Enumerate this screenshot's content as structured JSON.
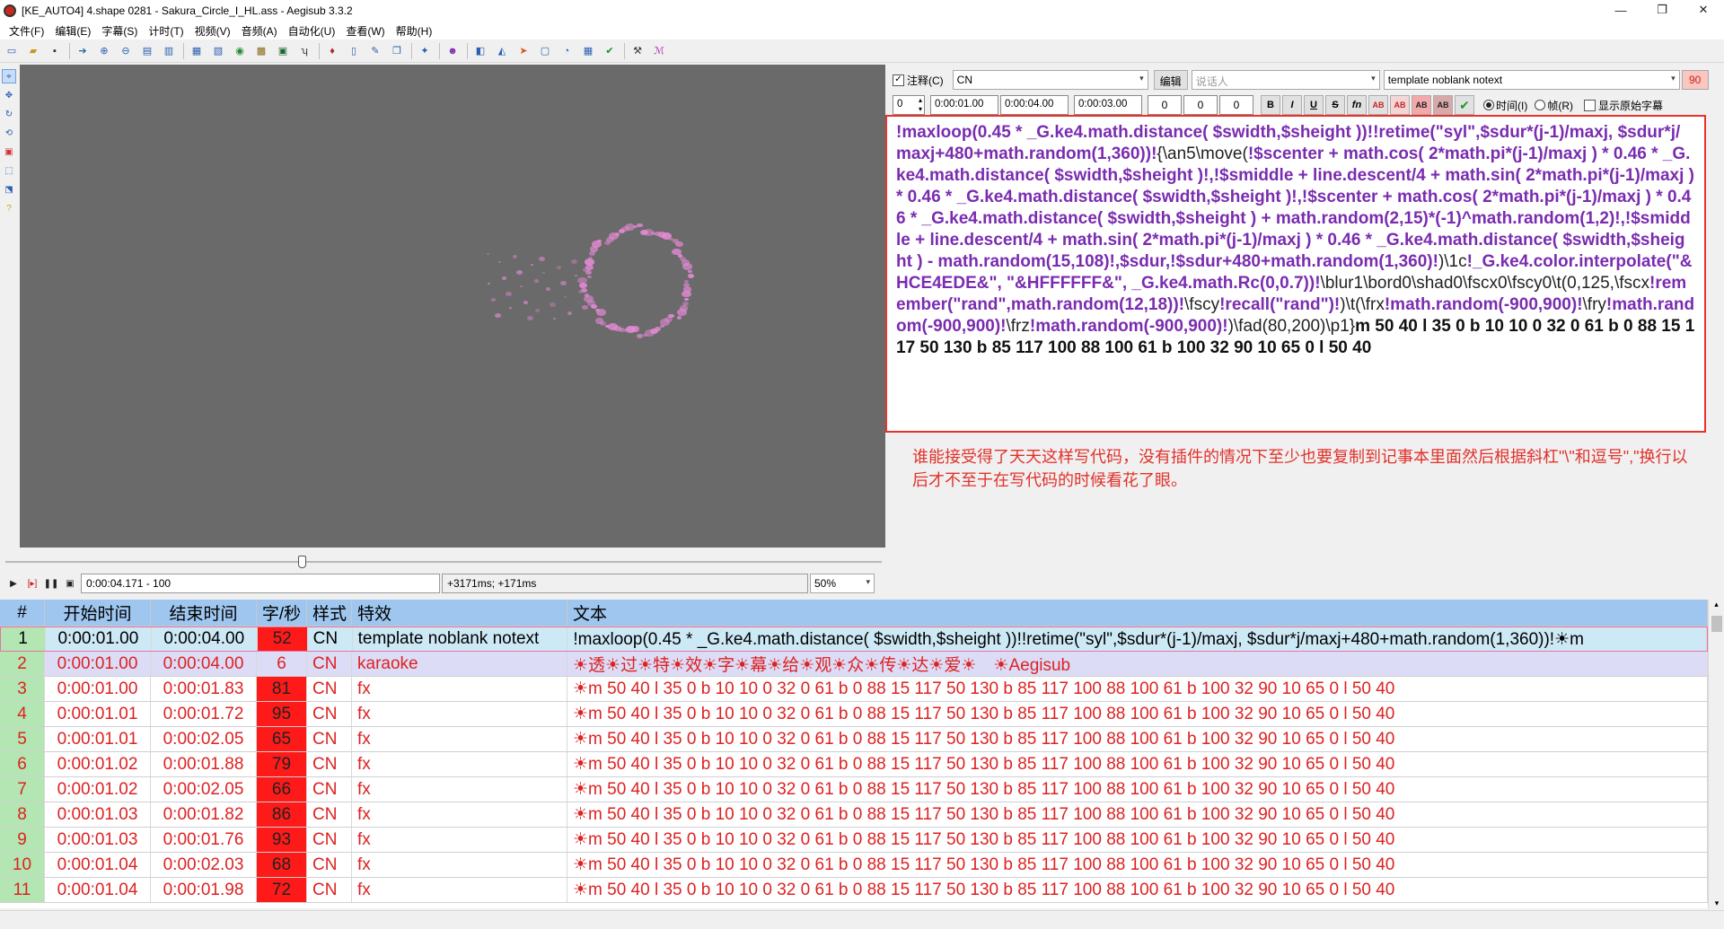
{
  "window": {
    "title": "[KE_AUTO4] 4.shape 0281 - Sakura_Circle_I_HL.ass - Aegisub 3.3.2",
    "controls": [
      "—",
      "❐",
      "✕"
    ]
  },
  "menu": [
    "文件(F)",
    "编辑(E)",
    "字幕(S)",
    "计时(T)",
    "视频(V)",
    "音频(A)",
    "自动化(U)",
    "查看(W)",
    "帮助(H)"
  ],
  "video_controls": {
    "time_display": "0:00:04.171 - 100",
    "offset_display": "+3171ms; +171ms",
    "zoom": "50%"
  },
  "edit": {
    "comment_label": "注释(C)",
    "style": "CN",
    "edit_button": "编辑",
    "actor_placeholder": "说话人",
    "effect": "template noblank notext",
    "char_count": "90",
    "layer": "0",
    "start_time": "0:00:01.00",
    "end_time": "0:00:04.00",
    "duration": "0:00:03.00",
    "margin_l": "0",
    "margin_r": "0",
    "margin_v": "0",
    "format_buttons": [
      "B",
      "I",
      "U",
      "S",
      "fn",
      "AB",
      "AB",
      "AB",
      "AB",
      "✔"
    ],
    "radio_time": "时间(I)",
    "radio_frame": "帧(R)",
    "show_original": "显示原始字幕",
    "code_parts": {
      "p1": "!maxloop(0.45 * _G.ke4.math.distance( $swidth,$sheight ))!!retime(\"syl\",$sdur*(j-1)/maxj, $sdur*j/maxj+480+math.random(1,360))!",
      "p2": "{\\an5\\move(",
      "p3": "!$scenter + math.cos( 2*math.pi*(j-1)/maxj ) * 0.46 * _G.ke4.math.distance( $swidth,$sheight )!,!$smiddle + line.descent/4 + math.sin( 2*math.pi*(j-1)/maxj ) * 0.46 * _G.ke4.math.distance( $swidth,$sheight )!,!$scenter + math.cos( 2*math.pi*(j-1)/maxj ) * 0.46 * _G.ke4.math.distance( $swidth,$sheight ) + math.random(2,15)*(-1)^math.random(1,2)!,!$smiddle + line.descent/4 + math.sin( 2*math.pi*(j-1)/maxj ) * 0.46 * _G.ke4.math.distance( $swidth,$sheight ) - math.random(15,108)!,$sdur,!$sdur+480+math.random(1,360)!",
      "p4": ")\\1c",
      "p5": "!_G.ke4.color.interpolate(\"&HCE4EDE&\", \"&HFFFFFF&\", _G.ke4.math.Rc(0,0.7))!",
      "p6": "\\blur1\\bord0\\shad0\\fscx0\\fscy0\\t(0,125,\\fscx",
      "p7": "!remember(\"rand\",math.random(12,18))!",
      "p8": "\\fscy",
      "p9": "!recall(\"rand\")!",
      "p10": ")\\t(\\frx",
      "p11": "!math.random(-900,900)!",
      "p12": "\\fry",
      "p13": "!math.random(-900,900)!",
      "p14": "\\frz",
      "p15": "!math.random(-900,900)!",
      "p16": ")\\fad(80,200)\\p1}",
      "p17": "m 50 40 l 35 0 b 10 10 0 32 0 61 b 0 88 15 117 50 130 b 85 117 100 88 100 61 b 100 32 90 10 65 0 l 50 40"
    },
    "note": "谁能接受得了天天这样写代码，没有插件的情况下至少也要复制到记事本里面然后根据斜杠\"\\\"和逗号\",\"换行以后才不至于在写代码的时候看花了眼。"
  },
  "grid": {
    "headers": [
      "#",
      "开始时间",
      "结束时间",
      "字/秒",
      "样式",
      "特效",
      "文本"
    ],
    "rows": [
      {
        "num": "1",
        "start": "0:00:01.00",
        "end": "0:00:04.00",
        "cps": "52",
        "style": "CN",
        "effect": "template noblank notext",
        "text": "!maxloop(0.45 * _G.ke4.math.distance( $swidth,$sheight ))!!retime(\"syl\",$sdur*(j-1)/maxj, $sdur*j/maxj+480+math.random(1,360))!☀m",
        "kind": "active"
      },
      {
        "num": "2",
        "start": "0:00:01.00",
        "end": "0:00:04.00",
        "cps": "6",
        "style": "CN",
        "effect": "karaoke",
        "text": "☀透☀过☀特☀效☀字☀幕☀给☀观☀众☀传☀达☀爱☀　☀Aegisub",
        "kind": "comment"
      },
      {
        "num": "3",
        "start": "0:00:01.00",
        "end": "0:00:01.83",
        "cps": "81",
        "style": "CN",
        "effect": "fx",
        "text": "☀m 50 40 l 35 0 b 10 10 0 32 0 61 b 0 88 15 117 50 130 b 85 117 100 88 100 61 b 100 32 90 10 65 0 l 50 40",
        "kind": "fx"
      },
      {
        "num": "4",
        "start": "0:00:01.01",
        "end": "0:00:01.72",
        "cps": "95",
        "style": "CN",
        "effect": "fx",
        "text": "☀m 50 40 l 35 0 b 10 10 0 32 0 61 b 0 88 15 117 50 130 b 85 117 100 88 100 61 b 100 32 90 10 65 0 l 50 40",
        "kind": "fx"
      },
      {
        "num": "5",
        "start": "0:00:01.01",
        "end": "0:00:02.05",
        "cps": "65",
        "style": "CN",
        "effect": "fx",
        "text": "☀m 50 40 l 35 0 b 10 10 0 32 0 61 b 0 88 15 117 50 130 b 85 117 100 88 100 61 b 100 32 90 10 65 0 l 50 40",
        "kind": "fx"
      },
      {
        "num": "6",
        "start": "0:00:01.02",
        "end": "0:00:01.88",
        "cps": "79",
        "style": "CN",
        "effect": "fx",
        "text": "☀m 50 40 l 35 0 b 10 10 0 32 0 61 b 0 88 15 117 50 130 b 85 117 100 88 100 61 b 100 32 90 10 65 0 l 50 40",
        "kind": "fx"
      },
      {
        "num": "7",
        "start": "0:00:01.02",
        "end": "0:00:02.05",
        "cps": "66",
        "style": "CN",
        "effect": "fx",
        "text": "☀m 50 40 l 35 0 b 10 10 0 32 0 61 b 0 88 15 117 50 130 b 85 117 100 88 100 61 b 100 32 90 10 65 0 l 50 40",
        "kind": "fx"
      },
      {
        "num": "8",
        "start": "0:00:01.03",
        "end": "0:00:01.82",
        "cps": "86",
        "style": "CN",
        "effect": "fx",
        "text": "☀m 50 40 l 35 0 b 10 10 0 32 0 61 b 0 88 15 117 50 130 b 85 117 100 88 100 61 b 100 32 90 10 65 0 l 50 40",
        "kind": "fx"
      },
      {
        "num": "9",
        "start": "0:00:01.03",
        "end": "0:00:01.76",
        "cps": "93",
        "style": "CN",
        "effect": "fx",
        "text": "☀m 50 40 l 35 0 b 10 10 0 32 0 61 b 0 88 15 117 50 130 b 85 117 100 88 100 61 b 100 32 90 10 65 0 l 50 40",
        "kind": "fx"
      },
      {
        "num": "10",
        "start": "0:00:01.04",
        "end": "0:00:02.03",
        "cps": "68",
        "style": "CN",
        "effect": "fx",
        "text": "☀m 50 40 l 35 0 b 10 10 0 32 0 61 b 0 88 15 117 50 130 b 85 117 100 88 100 61 b 100 32 90 10 65 0 l 50 40",
        "kind": "fx"
      },
      {
        "num": "11",
        "start": "0:00:01.04",
        "end": "0:00:01.98",
        "cps": "72",
        "style": "CN",
        "effect": "fx",
        "text": "☀m 50 40 l 35 0 b 10 10 0 32 0 61 b 0 88 15 117 50 130 b 85 117 100 88 100 61 b 100 32 90 10 65 0 l 50 40",
        "kind": "fx"
      }
    ]
  },
  "colors": {
    "accent_red": "#e8332a",
    "code_purple": "#7a2cb0",
    "header_blue": "#9ec6ef",
    "row_number_green": "#b3e6b2",
    "cps_warning": "#ff1a1a",
    "video_bg": "#6a6a6a",
    "petal_pink": "#e58ad7"
  }
}
